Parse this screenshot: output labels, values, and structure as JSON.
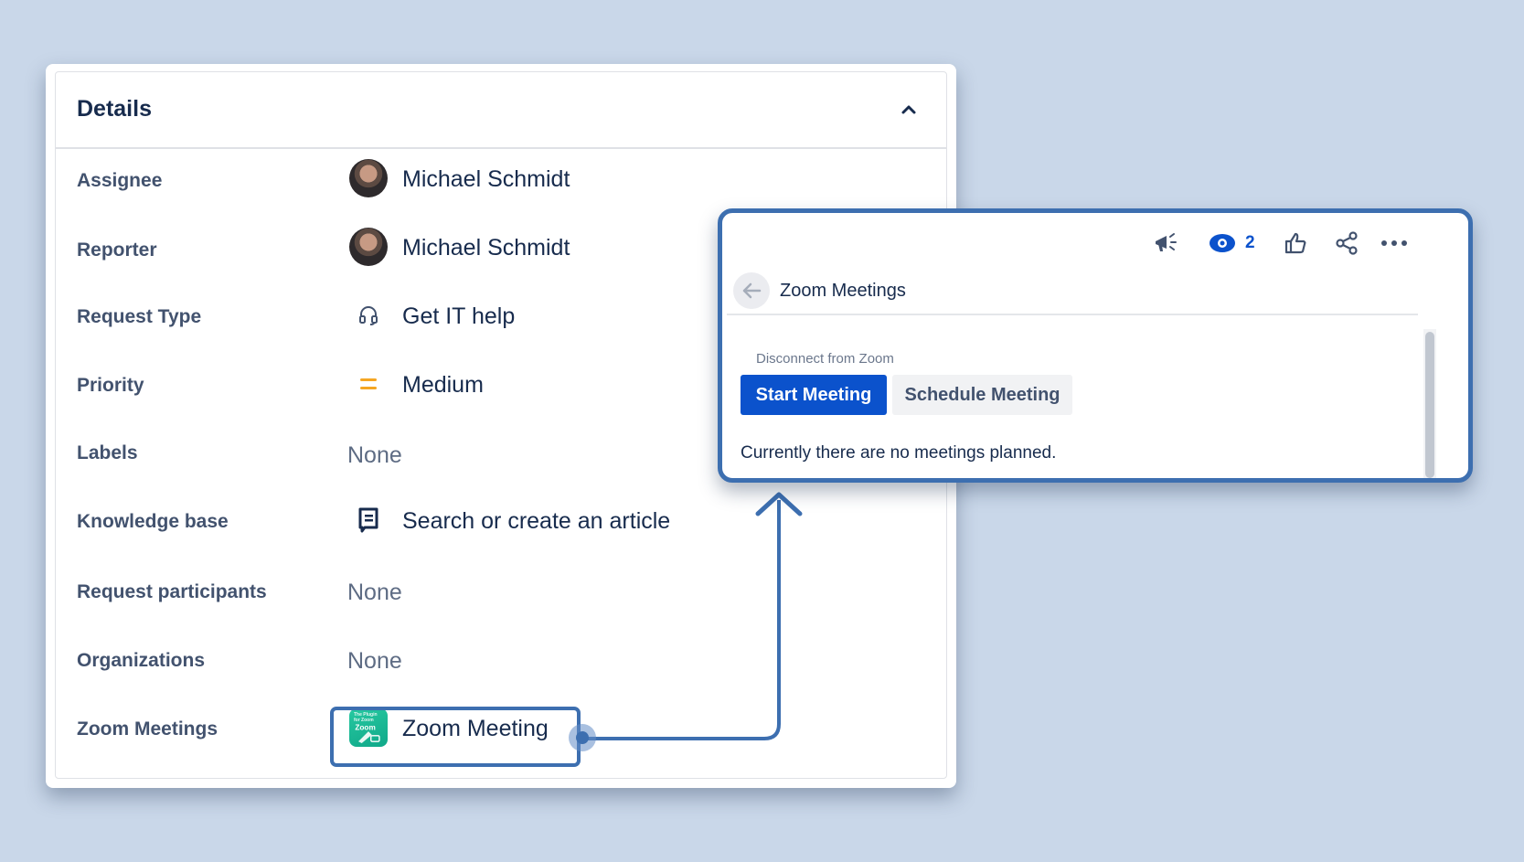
{
  "details": {
    "title": "Details",
    "fields": [
      {
        "label": "Assignee",
        "value": "Michael Schmidt",
        "icon": "avatar"
      },
      {
        "label": "Reporter",
        "value": "Michael Schmidt",
        "icon": "avatar"
      },
      {
        "label": "Request Type",
        "value": "Get IT help",
        "icon": "headset-icon"
      },
      {
        "label": "Priority",
        "value": "Medium",
        "icon": "priority-medium-icon"
      },
      {
        "label": "Labels",
        "value": "None"
      },
      {
        "label": "Knowledge base",
        "value": "Search or create an article",
        "icon": "knowledge-base-icon"
      },
      {
        "label": "Request participants",
        "value": "None"
      },
      {
        "label": "Organizations",
        "value": "None"
      },
      {
        "label": "Zoom Meetings",
        "value": "Zoom Meeting",
        "icon": "zoom-app-icon",
        "icon_text": "The Plugin for Zoom"
      }
    ]
  },
  "zoom_panel": {
    "toolbar": {
      "feedback_icon": "megaphone-icon",
      "watch_icon": "eye-icon",
      "watch_count": "2",
      "like_icon": "thumbs-up-icon",
      "share_icon": "share-icon",
      "more_icon": "more-icon"
    },
    "title": "Zoom Meetings",
    "disconnect_label": "Disconnect from Zoom",
    "start_button": "Start Meeting",
    "schedule_button": "Schedule Meeting",
    "empty_message": "Currently there are no meetings planned."
  },
  "colors": {
    "background": "#c9d7e9",
    "accent": "#3d6fb0",
    "primary_button": "#0b52cc",
    "priority_medium": "#f5a623",
    "zoom_green": "#1fbf97"
  }
}
